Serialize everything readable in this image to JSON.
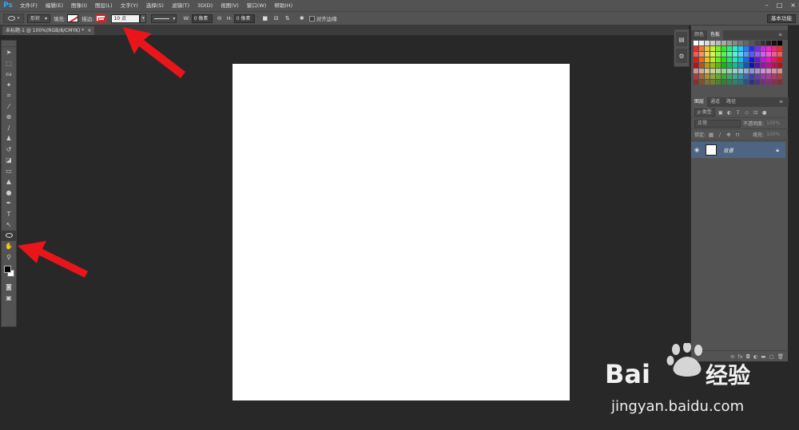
{
  "app": {
    "logo": "Ps"
  },
  "menu": [
    "文件(F)",
    "编辑(E)",
    "图像(I)",
    "图层(L)",
    "文字(Y)",
    "选择(S)",
    "滤镜(T)",
    "3D(D)",
    "视图(V)",
    "窗口(W)",
    "帮助(H)"
  ],
  "window_controls": [
    "–",
    "□",
    "×"
  ],
  "options": {
    "mode": "形状",
    "fill_label": "填充:",
    "stroke_label": "描边:",
    "stroke_width": "10 点",
    "w_label": "W:",
    "w_value": "0 像素",
    "h_label": "H:",
    "h_value": "0 像素",
    "align_edges": "对齐边缘",
    "workspace": "基本功能"
  },
  "document_tab": {
    "title": "未标题-1 @ 100%(RGB/8/CMYK) *",
    "close": "×"
  },
  "panels": {
    "color_tabs": [
      "颜色",
      "色板"
    ],
    "layers_tabs": [
      "图层",
      "通道",
      "路径"
    ],
    "kind_label": "ρ 类型",
    "blend_mode": "正常",
    "opacity_label": "不透明度:",
    "opacity_value": "100%",
    "lock_label": "锁定:",
    "fill_label": "填充:",
    "fill_value": "100%",
    "layer_name": "背景"
  },
  "accent": {
    "stroke_red": "#e02020",
    "arrow_red": "#e8161b",
    "layer_selected": "#4d6582"
  },
  "watermark": {
    "brand": "Bai",
    "brand_cn": "经验",
    "url": "jingyan.baidu.com"
  }
}
